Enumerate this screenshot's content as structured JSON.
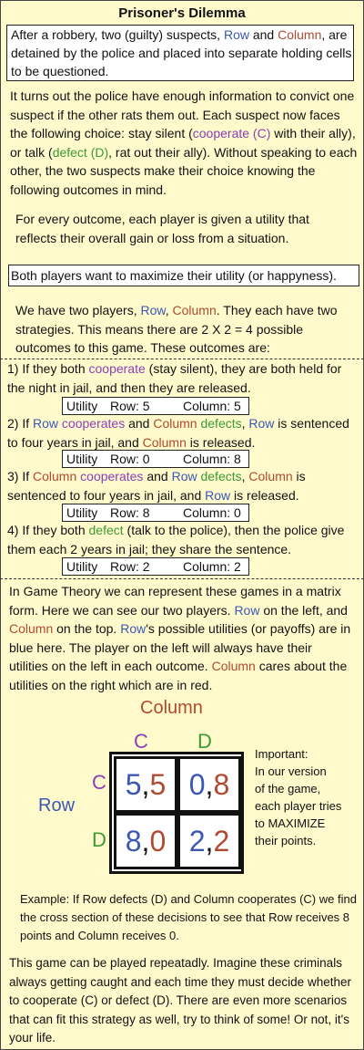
{
  "title": "Prisoner's Dilemma",
  "intro": {
    "p1": "After a robbery, two (guilty) suspects, ",
    "row": "Row",
    "and": " and ",
    "col": "Column",
    "p2": ", are detained by the police and placed into separate holding cells to be questioned."
  },
  "para1": {
    "a": "It turns out the police have enough information to convict one suspect if the other rats them out. Each suspect now faces the following choice: stay silent (",
    "coop": "cooperate (C)",
    "b": " with their ally), or talk (",
    "defect": "defect (D)",
    "c": ", rat out their ally). Without speaking to each other, the two suspects make their choice knowing the following outcomes in mind."
  },
  "para2": "For every outcome, each player is given a utility that reflects their overall gain or loss from a situation.",
  "goal": "Both players want to maximize their utility (or happyness).",
  "para3": {
    "a": "We have two players, ",
    "row": "Row",
    "b": ". ",
    "col": "Column",
    "c": "They each have two strategies. This means there are 2 X 2 = 4 possible outcomes to this game. These outcomes are:"
  },
  "outcomes": {
    "o1": {
      "a": "1) If they both ",
      "b": "cooperate",
      "c": " (stay silent), they are both held for the night in jail, and then they are released."
    },
    "o2": {
      "a": "2) If ",
      "row": "Row",
      "b": "cooperates",
      "c": " and ",
      "col": "Column",
      "d": "defects",
      "e": ", ",
      "row2": "Row",
      "f": " is sentenced to four years in jail, and ",
      "col2": "Column",
      "g": " is released."
    },
    "o3": {
      "a": "3) If ",
      "col": "Column",
      "b": "cooperates",
      "c": " and ",
      "row": "Row",
      "d": "defects",
      "e": ", ",
      "col2": "Column",
      "f": " is sentenced to four years in jail, and ",
      "row2": "Row",
      "g": " is released."
    },
    "o4": {
      "a": "4) If they both ",
      "b": "defect",
      "c": " (talk to the police), then the police give them each 2 years in jail; they share the sentence."
    }
  },
  "utilities": [
    {
      "label": "Utility",
      "row": "Row: 5",
      "col": "Column: 5"
    },
    {
      "label": "Utility",
      "row": "Row: 0",
      "col": "Column: 8"
    },
    {
      "label": "Utility",
      "row": "Row: 8",
      "col": "Column: 0"
    },
    {
      "label": "Utility",
      "row": "Row: 2",
      "col": "Column: 2"
    }
  ],
  "para4": {
    "a": "In Game Theory we can represent these games in a matrix form. Here we can see our two players. ",
    "row": "Row",
    "b": " on the left, and ",
    "col": "Column",
    "c": " on the top. ",
    "row2": "Row",
    "d": "'s possible utilities (or payoffs) are in blue here. The player on the left will always have their utilities on the left in each outcome. ",
    "col2": "Column",
    "e": " cares about the utilities on the right which are in red."
  },
  "matrix": {
    "col_player": "Column",
    "row_player": "Row",
    "col_strats": [
      "C",
      "D"
    ],
    "row_strats": [
      "C",
      "D"
    ],
    "cells": [
      [
        {
          "r": "5",
          "c": "5"
        },
        {
          "r": "0",
          "c": "8"
        }
      ],
      [
        {
          "r": "8",
          "c": "0"
        },
        {
          "r": "2",
          "c": "2"
        }
      ]
    ],
    "comma": ","
  },
  "important": {
    "head": "Important:",
    "body1": "In our version",
    "body2": "of the game,",
    "body3": "each player tries",
    "body4": "to MAXIMIZE",
    "body5": "their points."
  },
  "example": "Example: If Row defects (D) and Column cooperates (C) we find the cross section of these decisions to see that Row receives 8 points and Column receives 0.",
  "closing": "This game can be played repeatadly. Imagine these criminals always getting caught and each time they must decide whether to cooperate (C) or defect (D). There are even more scenarios that can fit this strategy as well, try to think of some! Or not, it's your life."
}
